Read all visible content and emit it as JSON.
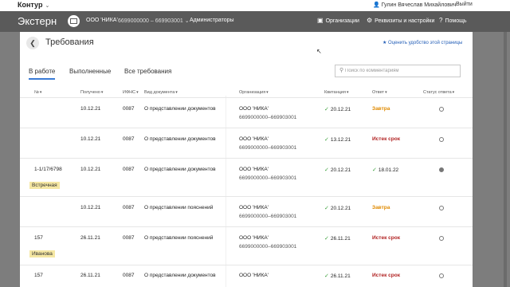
{
  "top": {
    "brand": "Контур",
    "user_name": "Гулин Вячеслав Михайлович",
    "logout": "Выйти"
  },
  "header": {
    "title": "Экстерн",
    "org_name": "ООО 'НИКА'",
    "org_inn": "6699000000 – 669903001 ⌄",
    "role": "Администраторы",
    "btn_orgs": "Организации",
    "btn_settings": "Реквизиты и настройки",
    "btn_help": "Помощь"
  },
  "page": {
    "title": "Требования",
    "rate_link": "★ Оценить удобство этой страницы",
    "tabs": [
      "В работе",
      "Выполненные",
      "Все требования"
    ],
    "search_placeholder": "Поиск по комментариям"
  },
  "columns": [
    "№",
    "Получено",
    "ИФНС",
    "Вид документа",
    "Организация",
    "Квитанция",
    "Ответ",
    "Статус ответа"
  ],
  "rows": [
    {
      "num": "",
      "received": "10.12.21",
      "ifns": "0087",
      "doc": "О представлении документов",
      "org": "ООО 'НИКА'",
      "inn": "6699000000–669903001",
      "receipt": "20.12.21",
      "answer": "Завтра",
      "answer_kind": "warn",
      "status": "empty",
      "tag": ""
    },
    {
      "num": "",
      "received": "10.12.21",
      "ifns": "0087",
      "doc": "О представлении документов",
      "org": "ООО 'НИКА'",
      "inn": "6699000000–669903001",
      "receipt": "13.12.21",
      "answer": "Истек срок",
      "answer_kind": "late",
      "status": "empty",
      "tag": ""
    },
    {
      "num": "1-1/17/6798",
      "received": "10.12.21",
      "ifns": "0087",
      "doc": "О представлении документов",
      "org": "ООО 'НИКА'",
      "inn": "6699000000–669903001",
      "receipt": "20.12.21",
      "answer": "18.01.22",
      "answer_kind": "ok",
      "status": "filled",
      "tag": "Встречная"
    },
    {
      "num": "",
      "received": "10.12.21",
      "ifns": "0087",
      "doc": "О представлении пояснений",
      "org": "ООО 'НИКА'",
      "inn": "6699000000–669903001",
      "receipt": "20.12.21",
      "answer": "Завтра",
      "answer_kind": "warn",
      "status": "empty",
      "tag": ""
    },
    {
      "num": "157",
      "received": "26.11.21",
      "ifns": "0087",
      "doc": "О представлении пояснений",
      "org": "ООО 'НИКА'",
      "inn": "6699000000–669903001",
      "receipt": "26.11.21",
      "answer": "Истек срок",
      "answer_kind": "late",
      "status": "empty",
      "tag": "Иванова"
    },
    {
      "num": "157",
      "received": "26.11.21",
      "ifns": "0087",
      "doc": "О представлении документов",
      "org": "ООО 'НИКА'",
      "inn": "",
      "receipt": "26.11.21",
      "answer": "Истек срок",
      "answer_kind": "late",
      "status": "empty",
      "tag": ""
    }
  ]
}
